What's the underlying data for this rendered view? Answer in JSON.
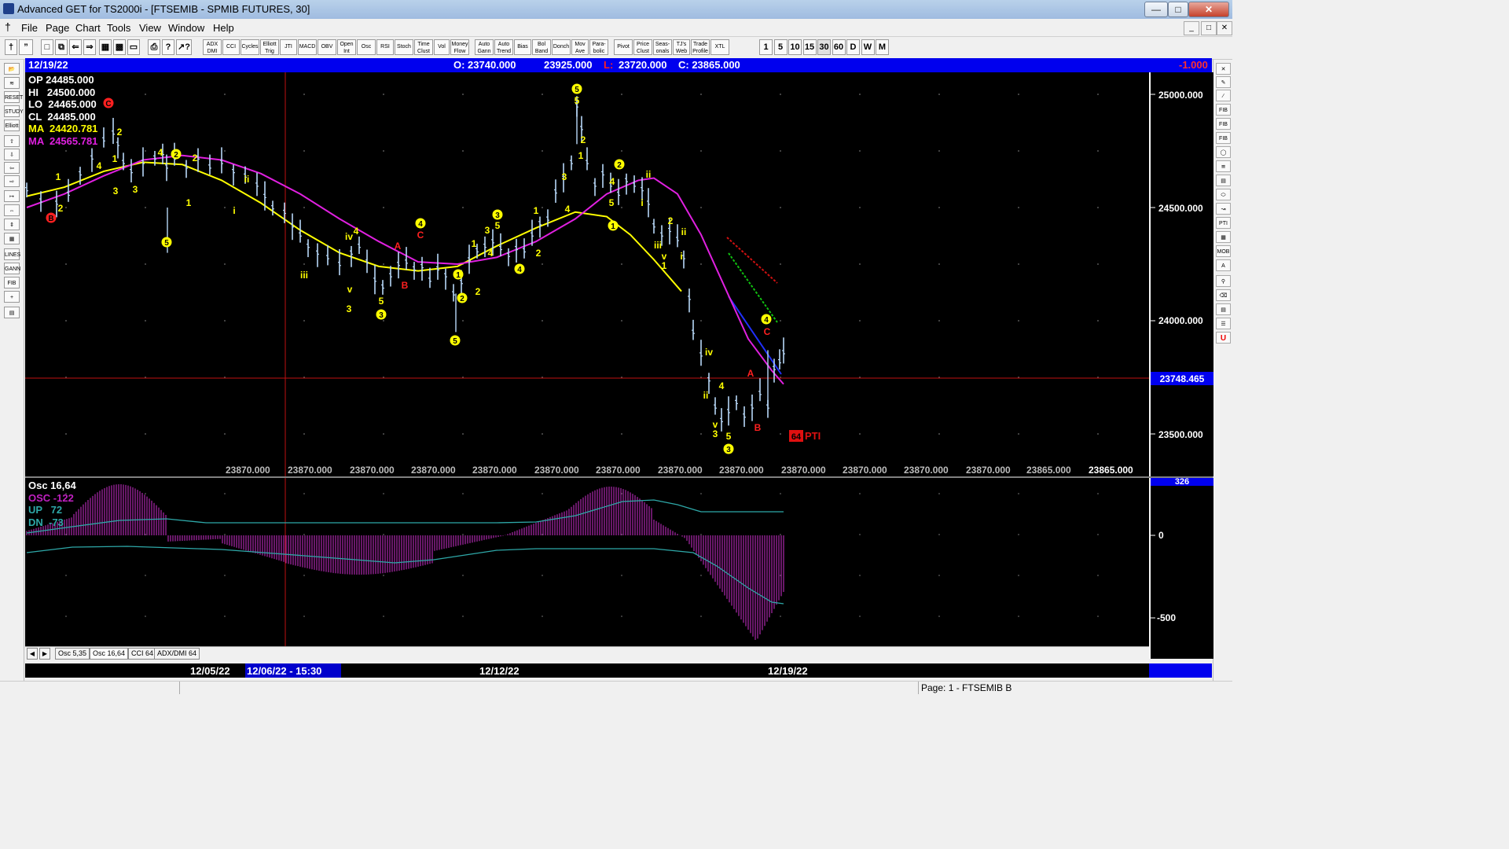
{
  "window": {
    "title": "Advanced GET for TS2000i - [FTSEMIB - SPMIB FUTURES, 30]"
  },
  "menu": [
    "File",
    "Page",
    "Chart",
    "Tools",
    "View",
    "Window",
    "Help"
  ],
  "toolbar": {
    "studies": [
      {
        "top": "ADX",
        "bottom": "DMI"
      },
      {
        "top": "CCI",
        "bottom": ""
      },
      {
        "top": "Cycles",
        "bottom": ""
      },
      {
        "top": "Elliott",
        "bottom": "Trig"
      },
      {
        "top": "JTI",
        "bottom": ""
      },
      {
        "top": "MACD",
        "bottom": ""
      },
      {
        "top": "OBV",
        "bottom": ""
      },
      {
        "top": "Open",
        "bottom": "Int"
      },
      {
        "top": "Osc",
        "bottom": ""
      },
      {
        "top": "RSI",
        "bottom": ""
      },
      {
        "top": "Stoch",
        "bottom": ""
      },
      {
        "top": "Time",
        "bottom": "Clust"
      },
      {
        "top": "Vol",
        "bottom": ""
      },
      {
        "top": "Money",
        "bottom": "Flow"
      },
      {
        "top": "Auto",
        "bottom": "Gann"
      },
      {
        "top": "Auto",
        "bottom": "Trend"
      },
      {
        "top": "Bias",
        "bottom": ""
      },
      {
        "top": "Bol",
        "bottom": "Band"
      },
      {
        "top": "Donch",
        "bottom": ""
      },
      {
        "top": "Mov",
        "bottom": "Ave"
      },
      {
        "top": "Para-",
        "bottom": "bolic"
      },
      {
        "top": "Pivot",
        "bottom": ""
      },
      {
        "top": "Price",
        "bottom": "Clust"
      },
      {
        "top": "Seas-",
        "bottom": "onals"
      },
      {
        "top": "TJ's",
        "bottom": "Web"
      },
      {
        "top": "Trade",
        "bottom": "Profile"
      },
      {
        "top": "XTL",
        "bottom": ""
      }
    ],
    "intervals": [
      "1",
      "5",
      "10",
      "15",
      "30",
      "60",
      "D",
      "W",
      "M"
    ]
  },
  "info_bar": {
    "date": "12/19/22",
    "open": "O: 23740.000",
    "high": "23925.000",
    "low_label": "L:",
    "low": "23720.000",
    "close": "C: 23865.000",
    "change": "-1.000"
  },
  "ohlc_panel": {
    "op": "OP 24485.000",
    "hi": "HI   24500.000",
    "lo": "LO  24465.000",
    "cl": "CL  24485.000",
    "ma1": "MA  24420.781",
    "ma2": "MA  24565.781"
  },
  "price_axis": {
    "labels": [
      "25000.000",
      "24500.000",
      "24000.000",
      "23500.000"
    ],
    "current": "23748.465"
  },
  "bottom_values": {
    "labels": [
      "23870.000",
      "23870.000",
      "23870.000",
      "23870.000",
      "23870.000",
      "23870.000",
      "23870.000",
      "23870.000",
      "23870.000",
      "23870.000",
      "23870.000",
      "23870.000",
      "23870.000",
      "23865.000"
    ],
    "last": "23865.000"
  },
  "pti": {
    "value": "64",
    "label": "PTI"
  },
  "osc_panel": {
    "title": "Osc 16,64",
    "osc": "OSC -122",
    "up": "UP   72",
    "dn": "DN  -73",
    "scale": [
      "326",
      "0",
      "-500"
    ]
  },
  "tabs": [
    "Osc 5,35",
    "Osc 16,64",
    "CCI 64",
    "ADX/DMI 64"
  ],
  "dates": {
    "d1": "12/05/22",
    "cursor": "12/06/22 - 15:30",
    "d2": "12/12/22",
    "d3": "12/19/22"
  },
  "status": {
    "page": "Page: 1 - FTSEMIB B"
  },
  "colors": {
    "ma_fast": "#ffff00",
    "ma_slow": "#e020e0",
    "bars": "#b8d8f8",
    "info_bar": "#0000ee",
    "wave_yellow": "#ffff00",
    "wave_red": "#ff2020",
    "osc_hist": "#d030d0",
    "osc_lines": "#2ea8a8"
  }
}
